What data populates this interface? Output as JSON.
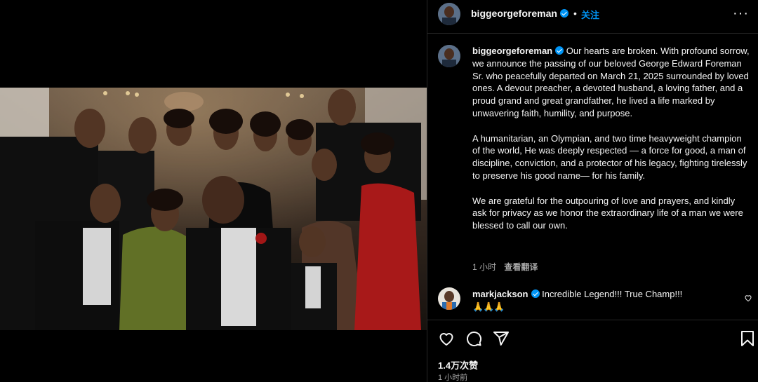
{
  "post": {
    "username": "biggeorgeforeman",
    "follow_label": "关注",
    "dot": "•",
    "more_label": "···"
  },
  "caption": {
    "username": "biggeorgeforeman",
    "paragraph1": "Our hearts are broken. With profound sorrow, we announce the passing of our beloved George Edward Foreman Sr. who peacefully departed on March 21, 2025 surrounded by loved ones. A devout preacher, a devoted husband, a loving father, and a proud grand and great grandfather, he lived a life marked by unwavering faith, humility, and purpose.",
    "paragraph2": "A humanitarian, an Olympian, and two time heavyweight champion of the world, He was deeply respected — a force for good, a man of discipline, conviction, and a protector of his legacy, fighting tirelessly to preserve his good name— for his family.",
    "paragraph3": "We are grateful for the outpouring of love and prayers, and kindly ask for privacy as we honor the extraordinary life of a man we were blessed to call our own.",
    "time": "1 小时",
    "translate_label": "查看翻译"
  },
  "comment": {
    "username": "markjackson",
    "text": "Incredible Legend!!! True Champ!!!",
    "emoji": "🙏🙏🙏"
  },
  "footer": {
    "likes": "1.4万次赞",
    "time": "1 小时前"
  },
  "icons": {
    "like": "heart-icon",
    "comment": "comment-icon",
    "share": "share-icon",
    "save": "bookmark-icon",
    "more": "more-options-icon",
    "verified": "verified-badge-icon"
  },
  "colors": {
    "background": "#000000",
    "text": "#f5f5f5",
    "secondary": "#a8a8a8",
    "accent": "#0095f6",
    "divider": "#262626"
  }
}
